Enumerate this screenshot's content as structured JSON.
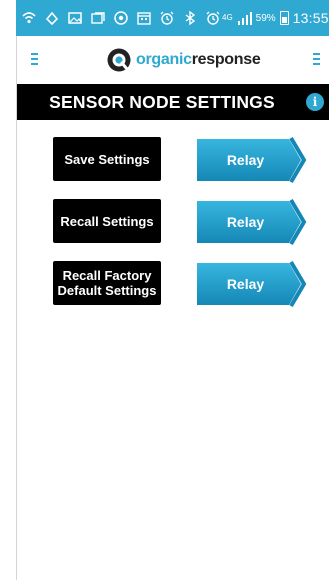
{
  "status_bar": {
    "icons": [
      "wifi-call-icon",
      "cast-icon",
      "gallery-icon",
      "media-icon",
      "vpn-icon",
      "calendar-icon",
      "alarm-icon",
      "bluetooth-icon",
      "alarm2-icon"
    ],
    "network": "4G",
    "battery_percent": "59%",
    "time": "13:55"
  },
  "header": {
    "logo_organic": "organic",
    "logo_response": "response"
  },
  "titlebar": {
    "title": "SENSOR NODE SETTINGS",
    "info_glyph": "i"
  },
  "rows": [
    {
      "action_label": "Save Settings",
      "relay_label": "Relay"
    },
    {
      "action_label": "Recall Settings",
      "relay_label": "Relay"
    },
    {
      "action_label": "Recall Factory Default Settings",
      "relay_label": "Relay"
    }
  ],
  "colors": {
    "accent": "#2fa8d2",
    "relay_gradient_top": "#37b6e0",
    "relay_gradient_bottom": "#1587b6",
    "titlebar_bg": "#000000",
    "button_bg": "#000000"
  }
}
